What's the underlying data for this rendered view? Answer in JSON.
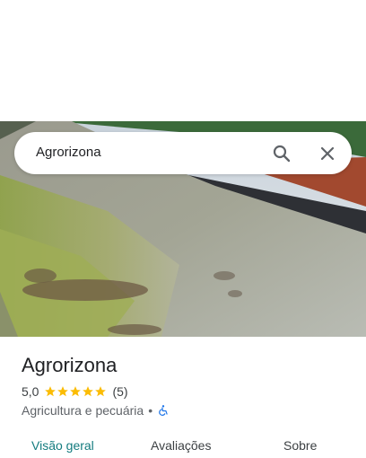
{
  "search": {
    "query": "Agrorizona"
  },
  "place": {
    "name": "Agrorizona",
    "rating": "5,0",
    "stars": 5,
    "review_count": "(5)",
    "category": "Agricultura e pecuária",
    "separator": "•"
  },
  "tabs": [
    {
      "label": "Visão geral",
      "active": true
    },
    {
      "label": "Avaliações",
      "active": false
    },
    {
      "label": "Sobre",
      "active": false
    }
  ],
  "colors": {
    "accent": "#137b7e",
    "star": "#fbbc04",
    "accessible_icon": "#1a73e8"
  },
  "icons": {
    "search": "search-icon",
    "close": "close-icon",
    "accessible": "wheelchair-icon"
  }
}
